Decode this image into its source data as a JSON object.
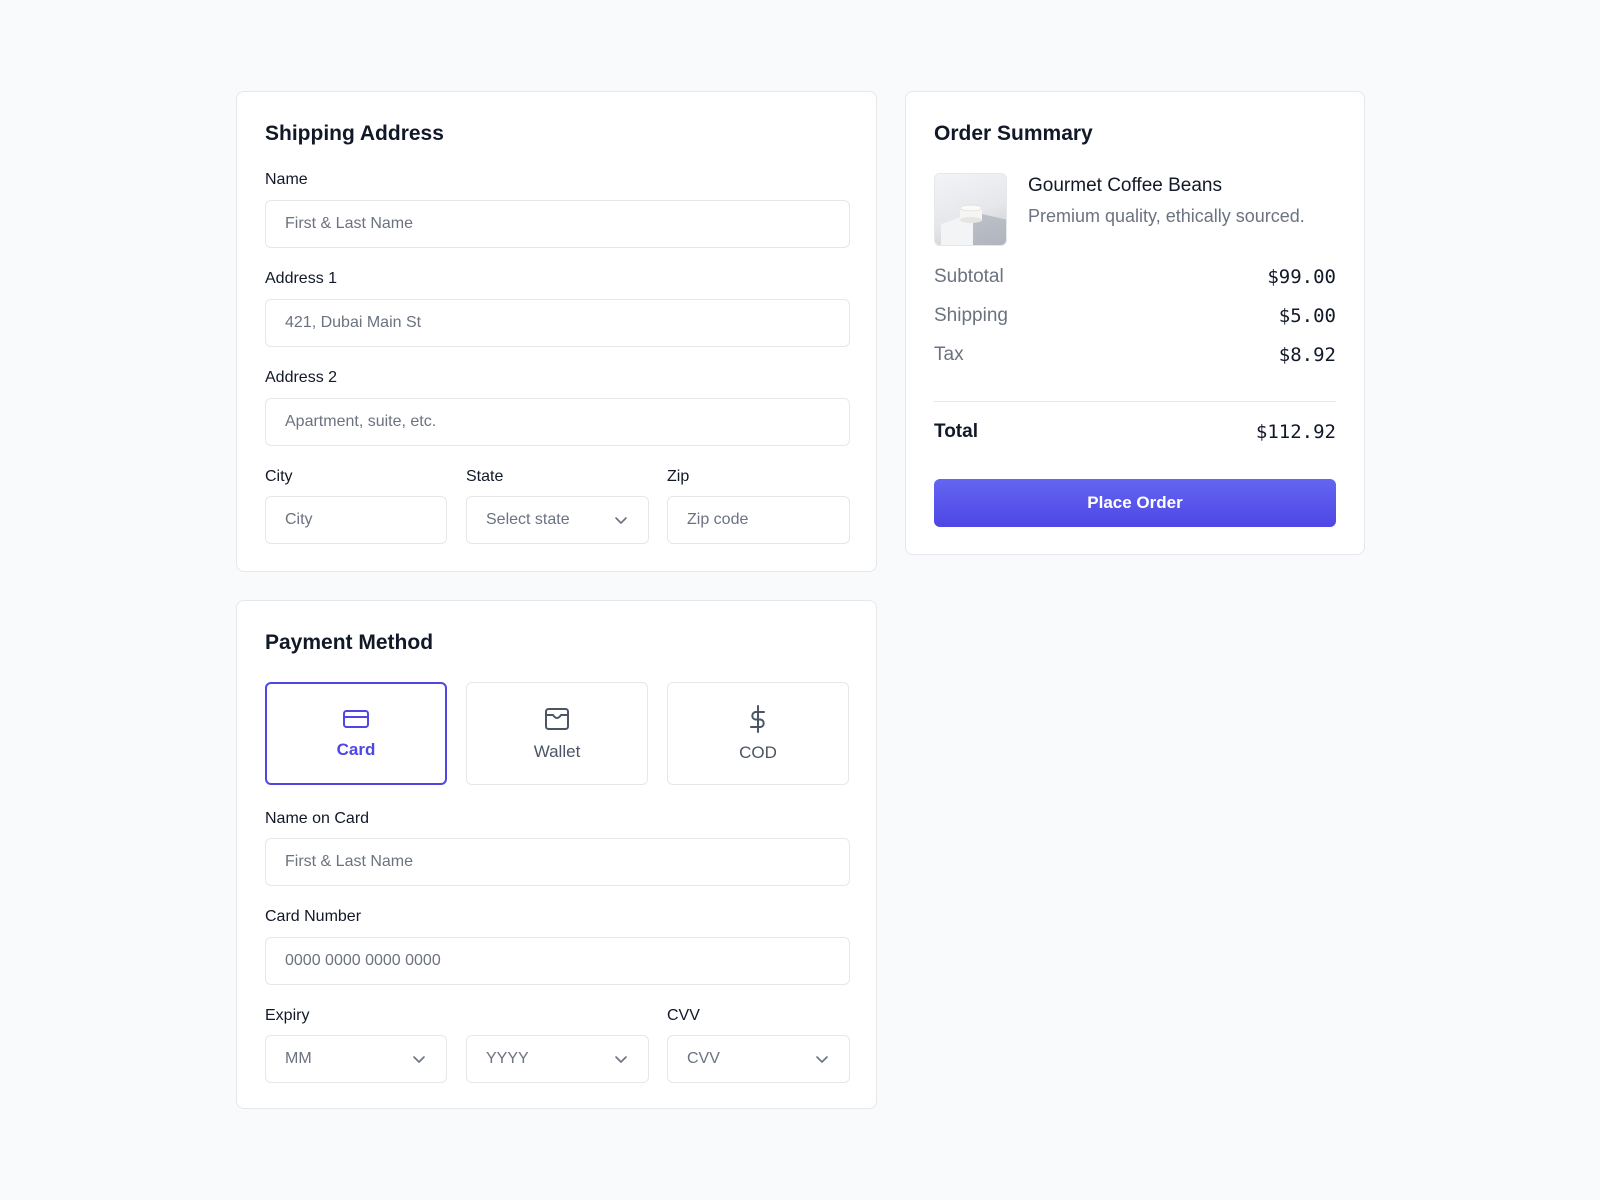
{
  "colors": {
    "accent": "#4f46e5",
    "border": "#e5e7eb",
    "muted": "#6b7280",
    "background": "#f9fafb"
  },
  "shipping": {
    "title": "Shipping Address",
    "name_label": "Name",
    "name_placeholder": "First & Last Name",
    "address1_label": "Address 1",
    "address1_value": "421, Dubai Main St",
    "address2_label": "Address 2",
    "address2_placeholder": "Apartment, suite, etc.",
    "city_label": "City",
    "city_placeholder": "City",
    "state_label": "State",
    "state_placeholder": "Select state",
    "zip_label": "Zip",
    "zip_placeholder": "Zip code"
  },
  "payment": {
    "title": "Payment Method",
    "methods": [
      {
        "label": "Card",
        "icon": "credit-card-icon",
        "selected": true
      },
      {
        "label": "Wallet",
        "icon": "wallet-icon",
        "selected": false
      },
      {
        "label": "COD",
        "icon": "dollar-icon",
        "selected": false
      }
    ],
    "name_on_card_label": "Name on Card",
    "name_on_card_placeholder": "First & Last Name",
    "card_number_label": "Card Number",
    "card_number_placeholder": "0000 0000 0000 0000",
    "expiry_label": "Expiry",
    "month_placeholder": "MM",
    "year_placeholder": "YYYY",
    "cvv_label": "CVV",
    "cvv_placeholder": "CVV"
  },
  "summary": {
    "title": "Order Summary",
    "product": {
      "name": "Gourmet Coffee Beans",
      "description": "Premium quality, ethically sourced."
    },
    "subtotal_label": "Subtotal",
    "subtotal_value": "$99.00",
    "shipping_label": "Shipping",
    "shipping_value": "$5.00",
    "tax_label": "Tax",
    "tax_value": "$8.92",
    "total_label": "Total",
    "total_value": "$112.92",
    "place_order_label": "Place Order"
  }
}
